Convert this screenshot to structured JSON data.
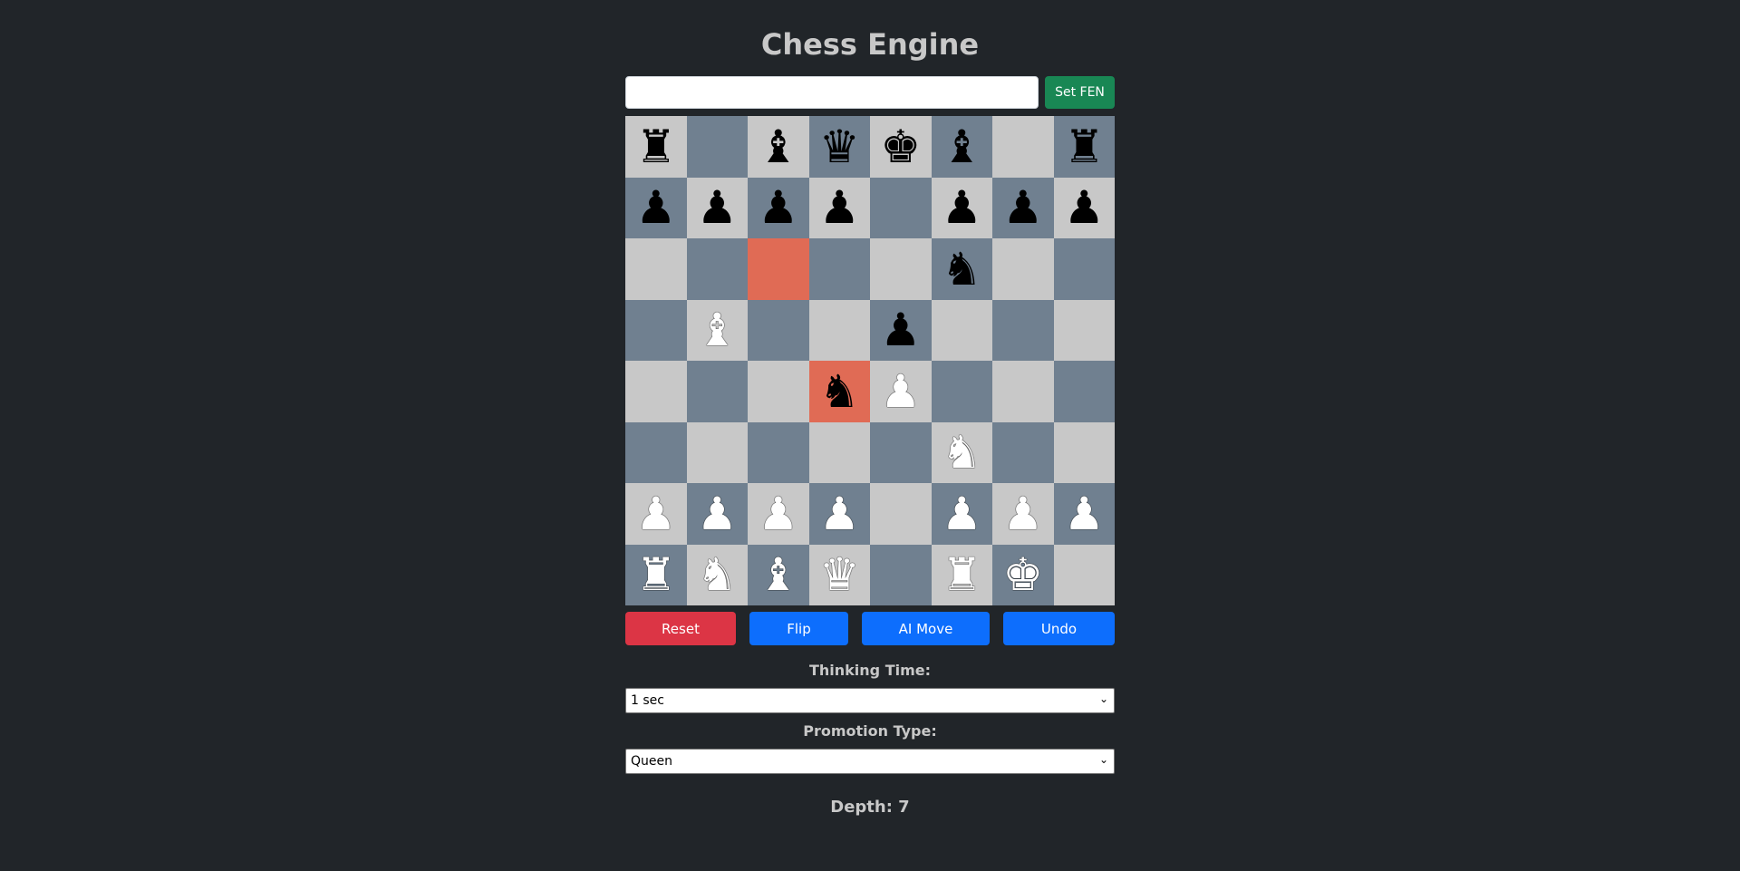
{
  "title": "Chess Engine",
  "fen": {
    "value": "",
    "placeholder": "",
    "button_label": "Set FEN"
  },
  "board": {
    "colors": {
      "light": "#c8c8c8",
      "dark": "#708090",
      "highlight": "#e06b55"
    },
    "highlighted": [
      "c6",
      "d4"
    ],
    "rows": [
      [
        "r",
        "",
        "b",
        "q",
        "k",
        "b",
        "",
        "r"
      ],
      [
        "p",
        "p",
        "p",
        "p",
        "",
        "p",
        "p",
        "p"
      ],
      [
        "",
        "",
        "",
        "",
        "",
        "n",
        "",
        ""
      ],
      [
        "",
        "B",
        "",
        "",
        "p",
        "",
        "",
        ""
      ],
      [
        "",
        "",
        "",
        "n",
        "P",
        "",
        "",
        ""
      ],
      [
        "",
        "",
        "",
        "",
        "",
        "N",
        "",
        ""
      ],
      [
        "P",
        "P",
        "P",
        "P",
        "",
        "P",
        "P",
        "P"
      ],
      [
        "R",
        "N",
        "B",
        "Q",
        "",
        "R",
        "K",
        ""
      ]
    ]
  },
  "controls": {
    "reset": "Reset",
    "flip": "Flip",
    "ai_move": "AI Move",
    "undo": "Undo",
    "colors": {
      "reset": "#dc3545",
      "primary": "#0d6efd",
      "fen": "#198754"
    }
  },
  "thinking_time": {
    "label": "Thinking Time:",
    "selected": "1 sec"
  },
  "promotion": {
    "label": "Promotion Type:",
    "selected": "Queen"
  },
  "depth": "Depth: 7"
}
